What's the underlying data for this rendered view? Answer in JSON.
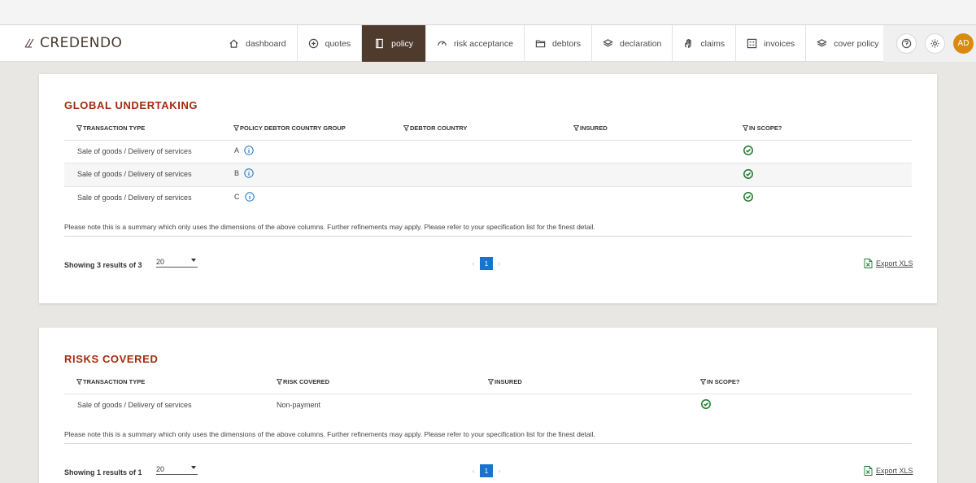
{
  "brand": {
    "name": "CREDENDO"
  },
  "nav": {
    "items": [
      {
        "label": "dashboard",
        "icon": "home-icon"
      },
      {
        "label": "quotes",
        "icon": "plus-circle-icon"
      },
      {
        "label": "policy",
        "icon": "document-icon",
        "active": true
      },
      {
        "label": "risk acceptance",
        "icon": "gauge-icon"
      },
      {
        "label": "debtors",
        "icon": "folder-icon"
      },
      {
        "label": "declaration",
        "icon": "layers-icon"
      },
      {
        "label": "claims",
        "icon": "hand-icon"
      },
      {
        "label": "invoices",
        "icon": "grid-icon"
      },
      {
        "label": "cover policy",
        "icon": "layers-icon"
      }
    ],
    "help_icon": "question-icon",
    "settings_icon": "gear-icon",
    "avatar_initials": "AD"
  },
  "global_undertaking": {
    "title": "GLOBAL UNDERTAKING",
    "columns": [
      "TRANSACTION TYPE",
      "POLICY DEBTOR COUNTRY GROUP",
      "DEBTOR COUNTRY",
      "INSURED",
      "IN SCOPE?"
    ],
    "rows": [
      {
        "transaction_type": "Sale of goods / Delivery of services",
        "country_group": "A",
        "debtor_country": "",
        "insured": "",
        "in_scope": true
      },
      {
        "transaction_type": "Sale of goods / Delivery of services",
        "country_group": "B",
        "debtor_country": "",
        "insured": "",
        "in_scope": true
      },
      {
        "transaction_type": "Sale of goods / Delivery of services",
        "country_group": "C",
        "debtor_country": "",
        "insured": "",
        "in_scope": true
      }
    ],
    "note": "Please note this is a summary which only uses the dimensions of the above columns. Further refinements may apply. Please refer to your specification list for the finest detail.",
    "showing": "Showing 3 results of 3",
    "per_page": "20",
    "page": "1",
    "export_label": "Export XLS"
  },
  "risks_covered": {
    "title": "RISKS COVERED",
    "columns": [
      "TRANSACTION TYPE",
      "RISK COVERED",
      "INSURED",
      "IN SCOPE?"
    ],
    "rows": [
      {
        "transaction_type": "Sale of goods / Delivery of services",
        "risk_covered": "Non-payment",
        "insured": "",
        "in_scope": true
      }
    ],
    "note": "Please note this is a summary which only uses the dimensions of the above columns. Further refinements may apply. Please refer to your specification list for the finest detail.",
    "showing": "Showing 1 results of 1",
    "per_page": "20",
    "page": "1",
    "export_label": "Export XLS"
  },
  "colors": {
    "brand_brown": "#4f3a2e",
    "title_red": "#a52a0c",
    "check_green": "#1f7a2e",
    "info_blue": "#1a73c8",
    "avatar_orange": "#d98b0f"
  }
}
